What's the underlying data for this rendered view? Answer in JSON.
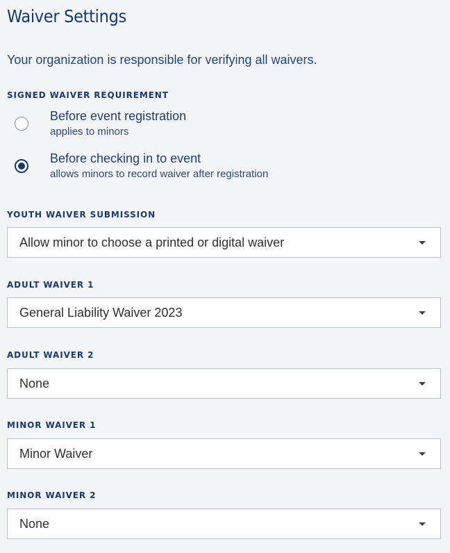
{
  "page": {
    "title": "Waiver Settings",
    "intro": "Your organization is responsible for verifying all waivers."
  },
  "signed_waiver_requirement": {
    "label": "SIGNED WAIVER REQUIREMENT",
    "options": [
      {
        "label": "Before event registration",
        "sublabel": "applies to minors",
        "selected": false
      },
      {
        "label": "Before checking in to event",
        "sublabel": "allows minors to record waiver after registration",
        "selected": true
      }
    ]
  },
  "youth_waiver_submission": {
    "label": "YOUTH WAIVER SUBMISSION",
    "value": "Allow minor to choose a printed or digital waiver"
  },
  "adult_waiver_1": {
    "label": "ADULT WAIVER 1",
    "value": "General Liability Waiver 2023"
  },
  "adult_waiver_2": {
    "label": "ADULT WAIVER 2",
    "value": "None"
  },
  "minor_waiver_1": {
    "label": "MINOR WAIVER 1",
    "value": "Minor Waiver"
  },
  "minor_waiver_2": {
    "label": "MINOR WAIVER 2",
    "value": "None"
  },
  "icons": {
    "dropdown": "caret-down-icon",
    "radio": "radio-icon"
  },
  "colors": {
    "background": "#f2f4f8",
    "primary_text": "#123a78",
    "border": "#b7c1d1",
    "field_background": "#ffffff"
  }
}
